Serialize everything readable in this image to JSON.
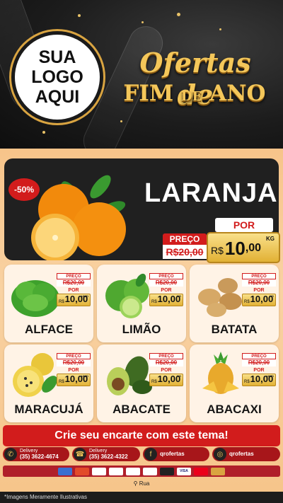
{
  "header": {
    "logo_lines": [
      "SUA",
      "LOGO",
      "AQUI"
    ],
    "title_line1": "Ofertas de",
    "title_line2_a": "FIM",
    "title_line2_b": "DE",
    "title_line2_c": "ANO"
  },
  "hero": {
    "discount": "-50%",
    "name": "LARANJA",
    "por_label": "POR",
    "preco_label": "PREÇO",
    "old_price": "R$20,00",
    "currency": "R$",
    "price_int": "10",
    "price_cents": ",00",
    "unit": "KG"
  },
  "price_labels": {
    "preco": "PREÇO",
    "por": "POR",
    "old": "R$20,00",
    "currency": "R$",
    "value": "10,00"
  },
  "products": [
    {
      "name": "ALFACE",
      "unit": "UNID"
    },
    {
      "name": "LIMÃO",
      "unit": "KG"
    },
    {
      "name": "BATATA",
      "unit": "KG"
    },
    {
      "name": "MARACUJÁ",
      "unit": "UNID"
    },
    {
      "name": "ABACATE",
      "unit": "KG"
    },
    {
      "name": "ABACAXI",
      "unit": "UNID"
    }
  ],
  "cta": "Crie seu encarte com este tema!",
  "contacts": [
    {
      "label": "Delivery",
      "value": "(35) 3622-4674",
      "icon": "whatsapp-icon"
    },
    {
      "label": "Delivery",
      "value": "(35) 3622-4322",
      "icon": "phone-icon"
    },
    {
      "label": "",
      "value": "qrofertas",
      "icon": "facebook-icon"
    },
    {
      "label": "",
      "value": "qrofertas",
      "icon": "instagram-icon"
    }
  ],
  "payment_methods": [
    "",
    "",
    "",
    "",
    "",
    "",
    "",
    "VISA",
    "",
    ""
  ],
  "address": "Rua",
  "footer_note": "*Imagens Meramente Ilustrativas",
  "colors": {
    "accent_red": "#d21c1c",
    "gold": "#f4c75a",
    "background": "#f7c48a"
  }
}
